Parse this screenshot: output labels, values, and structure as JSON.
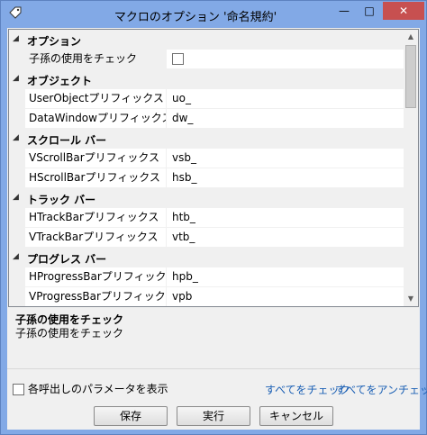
{
  "window": {
    "title": "マクロのオプション '命名規約'",
    "minimize_glyph": "—",
    "maximize_glyph": "□",
    "close_glyph": "✕"
  },
  "grid": {
    "categories": [
      {
        "label": "オプション",
        "props": [
          {
            "name": "子孫の使用をチェック",
            "value": "",
            "type": "checkbox",
            "checked": false
          }
        ]
      },
      {
        "label": "オブジェクト",
        "props": [
          {
            "name": "UserObjectプリフィックス",
            "value": "uo_"
          },
          {
            "name": "DataWindowプリフィックス",
            "value": "dw_"
          }
        ]
      },
      {
        "label": "スクロール バー",
        "props": [
          {
            "name": "VScrollBarプリフィックス",
            "value": "vsb_"
          },
          {
            "name": "HScrollBarプリフィックス",
            "value": "hsb_"
          }
        ]
      },
      {
        "label": "トラック バー",
        "props": [
          {
            "name": "HTrackBarプリフィックス",
            "value": "htb_"
          },
          {
            "name": "VTrackBarプリフィックス",
            "value": "vtb_"
          }
        ]
      },
      {
        "label": "プログレス バー",
        "props": [
          {
            "name": "HProgressBarプリフィックス",
            "value": "hpb_"
          },
          {
            "name": "VProgressBarプリフィックス",
            "value": "vpb"
          }
        ]
      }
    ]
  },
  "description": {
    "title": "子孫の使用をチェック",
    "body": "子孫の使用をチェック"
  },
  "footer": {
    "show_params_label": "各呼出しのパラメータを表示",
    "show_params_checked": false,
    "check_all": "すべてをチェック",
    "uncheck_all": "すべてをアンチェック",
    "save": "保存",
    "run": "実行",
    "cancel": "キャンセル"
  }
}
